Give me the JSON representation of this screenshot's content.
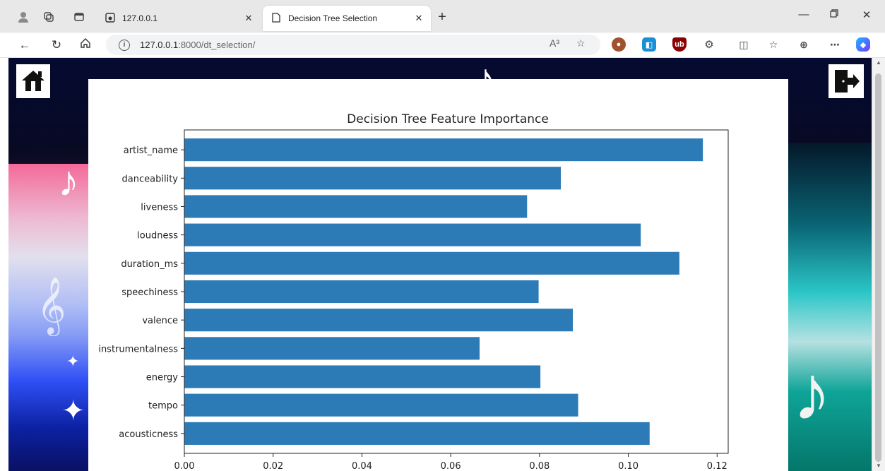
{
  "browser": {
    "tabs": [
      {
        "title": "127.0.0.1",
        "icon": "page-icon"
      },
      {
        "title": "Decision Tree Selection",
        "icon": "document-icon"
      }
    ],
    "url_host": "127.0.0.1",
    "url_path": ":8000/dt_selection/",
    "read_aloud_label": "A³"
  },
  "page": {
    "home_icon": "home-icon",
    "logout_icon": "logout-icon"
  },
  "colors": {
    "bar": "#2c7bb6"
  },
  "chart_data": {
    "type": "bar",
    "orientation": "horizontal",
    "title": "Decision Tree Feature Importance",
    "xlabel": "",
    "ylabel": "",
    "categories": [
      "artist_name",
      "danceability",
      "liveness",
      "loudness",
      "duration_ms",
      "speechiness",
      "valence",
      "instrumentalness",
      "energy",
      "tempo",
      "acousticness"
    ],
    "values": [
      0.1168,
      0.0848,
      0.0772,
      0.1028,
      0.1115,
      0.0798,
      0.0875,
      0.0665,
      0.0802,
      0.0887,
      0.1048
    ],
    "xlim": [
      0.0,
      0.1225
    ],
    "xticks": [
      0.0,
      0.02,
      0.04,
      0.06,
      0.08,
      0.1,
      0.12
    ],
    "xtick_labels": [
      "0.00",
      "0.02",
      "0.04",
      "0.06",
      "0.08",
      "0.10",
      "0.12"
    ],
    "grid": false,
    "legend": "none"
  }
}
